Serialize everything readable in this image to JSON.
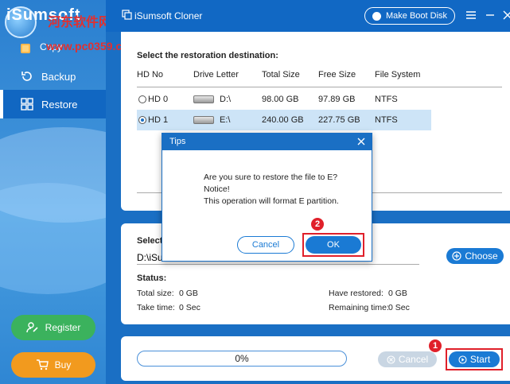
{
  "app": {
    "title": "iSumsoft Cloner",
    "logo_text": "iSumsoft",
    "make_boot_disk": "Make Boot Disk"
  },
  "watermark": {
    "line1": "河东软件网",
    "line2": "www.pc0359.cn"
  },
  "sidebar": {
    "copy_label": "Copy",
    "items": [
      {
        "label": "Backup",
        "icon": "backup-icon"
      },
      {
        "label": "Restore",
        "icon": "restore-icon",
        "active": true
      }
    ],
    "register_label": "Register",
    "buy_label": "Buy"
  },
  "destination": {
    "title": "Select the restoration destination:",
    "columns": [
      "HD No",
      "Drive Letter",
      "Total Size",
      "Free Size",
      "File System"
    ],
    "rows": [
      {
        "hd": "HD 0",
        "drive": "D:\\",
        "total": "98.00 GB",
        "free": "97.89 GB",
        "fs": "NTFS",
        "selected": false
      },
      {
        "hd": "HD 1",
        "drive": "E:\\",
        "total": "240.00 GB",
        "free": "227.75 GB",
        "fs": "NTFS",
        "selected": true
      }
    ]
  },
  "source": {
    "select_label": "Select",
    "path_value": "D:\\iSum",
    "choose_label": "Choose"
  },
  "status": {
    "label": "Status:",
    "total_size_label": "Total size:",
    "total_size_value": "0 GB",
    "take_time_label": "Take time:",
    "take_time_value": "0 Sec",
    "have_restored_label": "Have restored:",
    "have_restored_value": "0 GB",
    "remaining_time_label": "Remaining time:",
    "remaining_time_value": "0 Sec"
  },
  "progress": {
    "text": "0%",
    "value": 0
  },
  "actions": {
    "cancel_label": "Cancel",
    "start_label": "Start"
  },
  "dialog": {
    "title": "Tips",
    "line1": "Are you sure to restore the file to E?",
    "line2": "Notice!",
    "line3": "This operation will format E partition.",
    "cancel_label": "Cancel",
    "ok_label": "OK"
  },
  "markers": {
    "start": "1",
    "ok": "2"
  },
  "colors": {
    "primary": "#1a6fc4",
    "button": "#1a7ad4",
    "register": "#3bb25d",
    "buy": "#f29a1e",
    "highlight": "#e0202a",
    "selected_row": "#cde4f7"
  }
}
